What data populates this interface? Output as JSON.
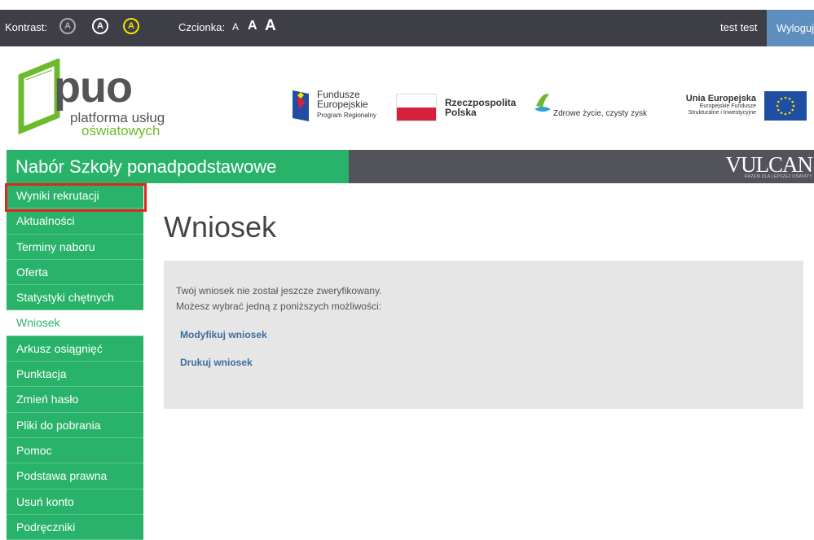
{
  "topbar": {
    "contrast_label": "Kontrast:",
    "contrast_buttons": [
      "A",
      "A",
      "A"
    ],
    "font_label": "Czcionka:",
    "font_sizes": [
      "A",
      "A",
      "A"
    ],
    "user_name": "test test",
    "logout_label": "Wyloguj"
  },
  "branding": {
    "puo_main": "puo",
    "puo_line1": "platforma usług",
    "puo_line2": "oświatowych",
    "fe_line1": "Fundusze",
    "fe_line2": "Europejskie",
    "fe_line3": "Program Regionalny",
    "rp_line1": "Rzeczpospolita",
    "rp_line2": "Polska",
    "zz_text": "Zdrowe życie, czysty zysk",
    "ue_line1": "Unia Europejska",
    "ue_line2": "Europejskie Fundusze",
    "ue_line3": "Strukturalne i Inwestycyjne",
    "vulcan": "VULCAN",
    "vulcan_sub": "RAZEM DLA LEPSZEJ OŚWIATY"
  },
  "app_title": "Nabór Szkoły ponadpodstawowe",
  "sidebar": {
    "items": [
      {
        "label": "Wyniki rekrutacji"
      },
      {
        "label": "Aktualności"
      },
      {
        "label": "Terminy naboru"
      },
      {
        "label": "Oferta"
      },
      {
        "label": "Statystyki chętnych"
      },
      {
        "label": "Wniosek"
      },
      {
        "label": "Arkusz osiągnięć"
      },
      {
        "label": "Punktacja"
      },
      {
        "label": "Zmień hasło"
      },
      {
        "label": "Pliki do pobrania"
      },
      {
        "label": "Pomoc"
      },
      {
        "label": "Podstawa prawna"
      },
      {
        "label": "Usuń konto"
      },
      {
        "label": "Podręczniki"
      }
    ],
    "active_item": "Wniosek",
    "highlighted_item": "Wyniki rekrutacji"
  },
  "main": {
    "title": "Wniosek",
    "message_line1": "Twój wniosek nie został jeszcze zweryfikowany.",
    "message_line2": "Możesz wybrać jedną z poniższych możliwości:",
    "link_modify": "Modyfikuj wniosek",
    "link_print": "Drukuj wniosek"
  },
  "colors": {
    "accent_green": "#29b36a",
    "topbar_bg": "#3e3e46",
    "logout_bg": "#5f8fbf",
    "link": "#3f6c9e",
    "highlight_red": "#e0261f"
  }
}
